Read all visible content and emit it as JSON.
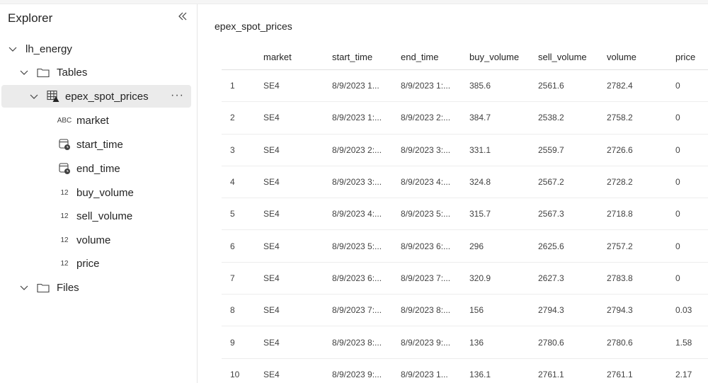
{
  "explorer": {
    "title": "Explorer",
    "collapse_icon": "double-chevron-left-icon",
    "workspace": "lh_energy",
    "tables_folder": "Tables",
    "table_name": "epex_spot_prices",
    "more_label": "···",
    "columns": [
      {
        "name": "market",
        "type_label": "ABC"
      },
      {
        "name": "start_time",
        "type_label": ""
      },
      {
        "name": "end_time",
        "type_label": ""
      },
      {
        "name": "buy_volume",
        "type_label": "12"
      },
      {
        "name": "sell_volume",
        "type_label": "12"
      },
      {
        "name": "volume",
        "type_label": "12"
      },
      {
        "name": "price",
        "type_label": "12"
      }
    ],
    "files_folder": "Files"
  },
  "preview": {
    "title": "epex_spot_prices",
    "headers": [
      "market",
      "start_time",
      "end_time",
      "buy_volume",
      "sell_volume",
      "volume",
      "price"
    ],
    "rows": [
      [
        "1",
        "SE4",
        "8/9/2023 1...",
        "8/9/2023 1:...",
        "385.6",
        "2561.6",
        "2782.4",
        "0"
      ],
      [
        "2",
        "SE4",
        "8/9/2023 1:...",
        "8/9/2023 2:...",
        "384.7",
        "2538.2",
        "2758.2",
        "0"
      ],
      [
        "3",
        "SE4",
        "8/9/2023 2:...",
        "8/9/2023 3:...",
        "331.1",
        "2559.7",
        "2726.6",
        "0"
      ],
      [
        "4",
        "SE4",
        "8/9/2023 3:...",
        "8/9/2023 4:...",
        "324.8",
        "2567.2",
        "2728.2",
        "0"
      ],
      [
        "5",
        "SE4",
        "8/9/2023 4:...",
        "8/9/2023 5:...",
        "315.7",
        "2567.3",
        "2718.8",
        "0"
      ],
      [
        "6",
        "SE4",
        "8/9/2023 5:...",
        "8/9/2023 6:...",
        "296",
        "2625.6",
        "2757.2",
        "0"
      ],
      [
        "7",
        "SE4",
        "8/9/2023 6:...",
        "8/9/2023 7:...",
        "320.9",
        "2627.3",
        "2783.8",
        "0"
      ],
      [
        "8",
        "SE4",
        "8/9/2023 7:...",
        "8/9/2023 8:...",
        "156",
        "2794.3",
        "2794.3",
        "0.03"
      ],
      [
        "9",
        "SE4",
        "8/9/2023 8:...",
        "8/9/2023 9:...",
        "136",
        "2780.6",
        "2780.6",
        "1.58"
      ],
      [
        "10",
        "SE4",
        "8/9/2023 9:...",
        "8/9/2023 1...",
        "136.1",
        "2761.1",
        "2761.1",
        "2.17"
      ]
    ]
  }
}
